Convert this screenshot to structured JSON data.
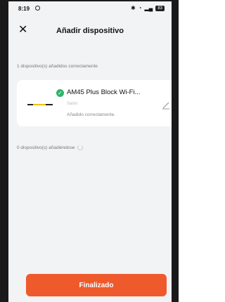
{
  "status_bar": {
    "time": "8:19",
    "battery": "83"
  },
  "header": {
    "title": "Añadir dispositivo"
  },
  "sections": {
    "added_label": "1 dispositivo(s) añadidos correctamente",
    "adding_label": "0 dispositivo(s) añadiéndose"
  },
  "device": {
    "name": "AM45 Plus Block Wi-Fi...",
    "room": "Salón",
    "status": "Añadido correctamente."
  },
  "footer": {
    "finish_label": "Finalizado"
  },
  "colors": {
    "accent": "#ef5a2c",
    "success": "#2fb36b",
    "background": "#f2f3f5"
  }
}
